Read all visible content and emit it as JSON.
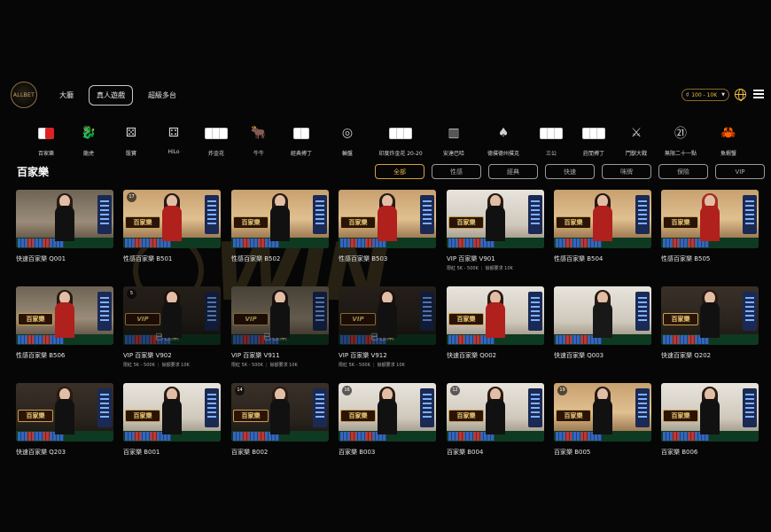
{
  "header": {
    "logo_text": "ALLBET",
    "tabs": [
      {
        "label": "大廳",
        "active": false
      },
      {
        "label": "真人遊戲",
        "active": true
      },
      {
        "label": "超級多台",
        "active": false
      }
    ],
    "balance": {
      "currency": "₫",
      "range": "100 - 10K"
    },
    "icons": [
      "globe-icon",
      "menu-icon"
    ]
  },
  "categories": [
    {
      "label": "百家樂",
      "icon": "cards-icon"
    },
    {
      "label": "龍虎",
      "icon": "dragon-tiger-icon"
    },
    {
      "label": "骰寶",
      "icon": "dice-icon"
    },
    {
      "label": "HiLo",
      "icon": "hilo-icon"
    },
    {
      "label": "炸金花",
      "icon": "win-three-cards-icon"
    },
    {
      "label": "牛牛",
      "icon": "bull-icon"
    },
    {
      "label": "經典搏丁",
      "icon": "pok-deng-icon"
    },
    {
      "label": "輪盤",
      "icon": "roulette-icon"
    },
    {
      "label": "印度炸金花 20-20",
      "icon": "teen-patti-icon"
    },
    {
      "label": "安達巴哈",
      "icon": "andar-bahar-icon"
    },
    {
      "label": "德撲德州撲克",
      "icon": "texas-holdem-icon"
    },
    {
      "label": "三公",
      "icon": "sam-gong-icon"
    },
    {
      "label": "莊閒搏丁",
      "icon": "banker-player-icon"
    },
    {
      "label": "鬥獸大戰",
      "icon": "swords-icon"
    },
    {
      "label": "無限二十一點",
      "icon": "blackjack-21-icon"
    },
    {
      "label": "魚蝦蟹",
      "icon": "fish-prawn-crab-icon"
    }
  ],
  "section": {
    "title": "百家樂"
  },
  "filters": [
    {
      "label": "全部",
      "active": true
    },
    {
      "label": "性感",
      "active": false
    },
    {
      "label": "經典",
      "active": false
    },
    {
      "label": "快速",
      "active": false
    },
    {
      "label": "咪牌",
      "active": false
    },
    {
      "label": "保險",
      "active": false
    },
    {
      "label": "VIP",
      "active": false
    }
  ],
  "limit_labels": {
    "limit": "限紅",
    "min": "餘額要求"
  },
  "games": [
    {
      "title": "快速百家樂 Q001",
      "badge": "",
      "tag": "",
      "bg": "a",
      "hair": "",
      "outfit": ""
    },
    {
      "title": "性感百家樂 B501",
      "badge": "17",
      "tag": "百家樂",
      "bg": "b",
      "hair": "",
      "outfit": "red"
    },
    {
      "title": "性感百家樂 B502",
      "badge": "",
      "tag": "百家樂",
      "bg": "b",
      "hair": "",
      "outfit": ""
    },
    {
      "title": "性感百家樂 B503",
      "badge": "",
      "tag": "百家樂",
      "bg": "b",
      "hair": "",
      "outfit": "red"
    },
    {
      "title": "VIP 百家樂 V901",
      "badge": "",
      "tag": "百家樂",
      "bg": "d",
      "hair": "",
      "outfit": "",
      "limits": {
        "range": "5K - 500K",
        "min": "10K"
      }
    },
    {
      "title": "性感百家樂 B504",
      "badge": "",
      "tag": "百家樂",
      "bg": "b",
      "hair": "",
      "outfit": "red"
    },
    {
      "title": "性感百家樂 B505",
      "badge": "",
      "tag": "百家樂",
      "bg": "b",
      "hair": "red",
      "outfit": "red"
    },
    {
      "title": "性感百家樂 B506",
      "badge": "",
      "tag": "百家樂",
      "bg": "a",
      "hair": "",
      "outfit": "red"
    },
    {
      "title": "VIP 百家樂 V902",
      "badge": "5",
      "tag": "VIP",
      "bg": "c",
      "hair": "",
      "outfit": "",
      "occupied": "已包桌",
      "limits": {
        "range": "5K - 500K",
        "min": "10K"
      }
    },
    {
      "title": "VIP 百家樂 V911",
      "badge": "",
      "tag": "VIP",
      "bg": "a",
      "hair": "",
      "outfit": "",
      "occupied": "已包桌",
      "limits": {
        "range": "5K - 500K",
        "min": "10K"
      }
    },
    {
      "title": "VIP 百家樂 V912",
      "badge": "",
      "tag": "VIP",
      "bg": "c",
      "hair": "",
      "outfit": "",
      "occupied": "已包桌",
      "limits": {
        "range": "5K - 500K",
        "min": "10K"
      }
    },
    {
      "title": "快速百家樂 Q002",
      "badge": "",
      "tag": "百家樂",
      "bg": "d",
      "hair": "",
      "outfit": "red"
    },
    {
      "title": "快速百家樂 Q003",
      "badge": "",
      "tag": "",
      "bg": "d",
      "hair": "",
      "outfit": "suit"
    },
    {
      "title": "快速百家樂 Q202",
      "badge": "",
      "tag": "百家樂",
      "bg": "c",
      "hair": "",
      "outfit": ""
    },
    {
      "title": "快速百家樂 Q203",
      "badge": "",
      "tag": "百家樂",
      "bg": "c",
      "hair": "",
      "outfit": ""
    },
    {
      "title": "百家樂 B001",
      "badge": "",
      "tag": "百家樂",
      "bg": "d",
      "hair": "",
      "outfit": ""
    },
    {
      "title": "百家樂 B002",
      "badge": "14",
      "tag": "百家樂",
      "bg": "c",
      "hair": "",
      "outfit": ""
    },
    {
      "title": "百家樂 B003",
      "badge": "16",
      "tag": "百家樂",
      "bg": "d",
      "hair": "",
      "outfit": ""
    },
    {
      "title": "百家樂 B004",
      "badge": "12",
      "tag": "百家樂",
      "bg": "d",
      "hair": "",
      "outfit": ""
    },
    {
      "title": "百家樂 B005",
      "badge": "19",
      "tag": "百家樂",
      "bg": "b",
      "hair": "",
      "outfit": ""
    },
    {
      "title": "百家樂 B006",
      "badge": "",
      "tag": "百家樂",
      "bg": "d",
      "hair": "",
      "outfit": ""
    }
  ]
}
